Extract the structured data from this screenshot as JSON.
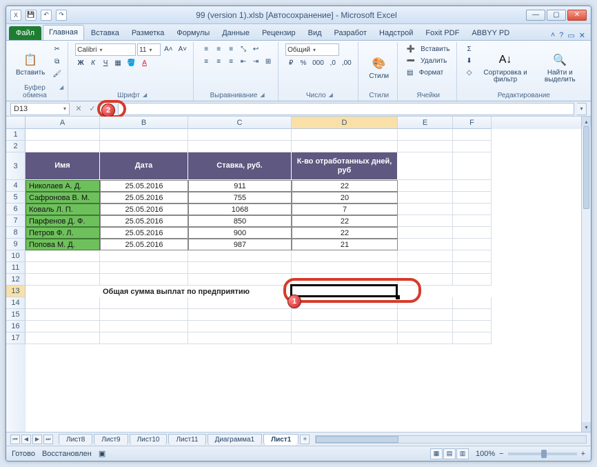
{
  "window": {
    "title": "99 (version 1).xlsb  [Автосохранение]  -  Microsoft Excel"
  },
  "qat": {
    "save": "💾",
    "undo": "↶",
    "redo": "↷"
  },
  "tabs": {
    "file": "Файл",
    "items": [
      "Главная",
      "Вставка",
      "Разметка",
      "Формулы",
      "Данные",
      "Рецензир",
      "Вид",
      "Разработ",
      "Надстрой",
      "Foxit PDF",
      "ABBYY PD"
    ],
    "active_index": 0
  },
  "ribbon": {
    "clipboard": {
      "label": "Буфер обмена",
      "paste": "Вставить"
    },
    "font": {
      "label": "Шрифт",
      "name": "Calibri",
      "size": "11"
    },
    "align": {
      "label": "Выравнивание"
    },
    "number": {
      "label": "Число",
      "format": "Общий"
    },
    "styles": {
      "label": "Стили",
      "btn": "Стили"
    },
    "cells": {
      "label": "Ячейки",
      "insert": "Вставить",
      "delete": "Удалить",
      "format": "Формат"
    },
    "editing": {
      "label": "Редактирование",
      "sort": "Сортировка и фильтр",
      "find": "Найти и выделить"
    }
  },
  "name_box": "D13",
  "columns": [
    "A",
    "B",
    "C",
    "D",
    "E",
    "F"
  ],
  "selected_col_index": 3,
  "selected_row": 13,
  "table": {
    "headers": [
      "Имя",
      "Дата",
      "Ставка, руб.",
      "К-во отработанных дней, руб"
    ],
    "rows": [
      [
        "Николаев А. Д.",
        "25.05.2016",
        "911",
        "22"
      ],
      [
        "Сафронова В. М.",
        "25.05.2016",
        "755",
        "20"
      ],
      [
        "Коваль Л. П.",
        "25.05.2016",
        "1068",
        "7"
      ],
      [
        "Парфенов Д. Ф.",
        "25.05.2016",
        "850",
        "22"
      ],
      [
        "Петров Ф. Л.",
        "25.05.2016",
        "900",
        "22"
      ],
      [
        "Попова М. Д.",
        "25.05.2016",
        "987",
        "21"
      ]
    ]
  },
  "label_row": "Общая сумма выплат по предприятию",
  "sheet_tabs": [
    "Лист8",
    "Лист9",
    "Лист10",
    "Лист11",
    "Диаграмма1",
    "Лист1"
  ],
  "active_sheet_index": 5,
  "status": {
    "ready": "Готово",
    "recovered": "Восстановлен",
    "zoom": "100%"
  },
  "callouts": {
    "one": "1",
    "two": "2"
  }
}
